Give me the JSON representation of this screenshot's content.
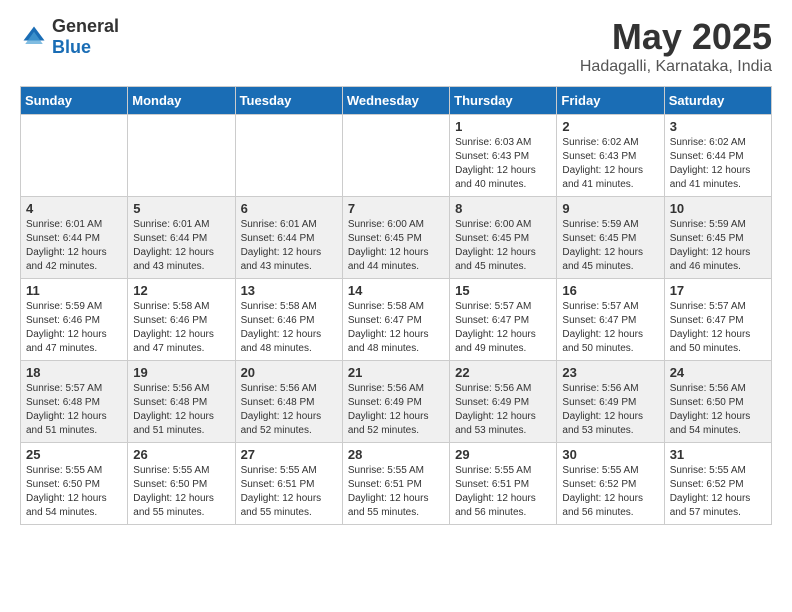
{
  "header": {
    "logo": {
      "general": "General",
      "blue": "Blue"
    },
    "title": "May 2025",
    "subtitle": "Hadagalli, Karnataka, India"
  },
  "weekdays": [
    "Sunday",
    "Monday",
    "Tuesday",
    "Wednesday",
    "Thursday",
    "Friday",
    "Saturday"
  ],
  "weeks": [
    [
      {
        "day": "",
        "info": ""
      },
      {
        "day": "",
        "info": ""
      },
      {
        "day": "",
        "info": ""
      },
      {
        "day": "",
        "info": ""
      },
      {
        "day": "1",
        "info": "Sunrise: 6:03 AM\nSunset: 6:43 PM\nDaylight: 12 hours\nand 40 minutes."
      },
      {
        "day": "2",
        "info": "Sunrise: 6:02 AM\nSunset: 6:43 PM\nDaylight: 12 hours\nand 41 minutes."
      },
      {
        "day": "3",
        "info": "Sunrise: 6:02 AM\nSunset: 6:44 PM\nDaylight: 12 hours\nand 41 minutes."
      }
    ],
    [
      {
        "day": "4",
        "info": "Sunrise: 6:01 AM\nSunset: 6:44 PM\nDaylight: 12 hours\nand 42 minutes."
      },
      {
        "day": "5",
        "info": "Sunrise: 6:01 AM\nSunset: 6:44 PM\nDaylight: 12 hours\nand 43 minutes."
      },
      {
        "day": "6",
        "info": "Sunrise: 6:01 AM\nSunset: 6:44 PM\nDaylight: 12 hours\nand 43 minutes."
      },
      {
        "day": "7",
        "info": "Sunrise: 6:00 AM\nSunset: 6:45 PM\nDaylight: 12 hours\nand 44 minutes."
      },
      {
        "day": "8",
        "info": "Sunrise: 6:00 AM\nSunset: 6:45 PM\nDaylight: 12 hours\nand 45 minutes."
      },
      {
        "day": "9",
        "info": "Sunrise: 5:59 AM\nSunset: 6:45 PM\nDaylight: 12 hours\nand 45 minutes."
      },
      {
        "day": "10",
        "info": "Sunrise: 5:59 AM\nSunset: 6:45 PM\nDaylight: 12 hours\nand 46 minutes."
      }
    ],
    [
      {
        "day": "11",
        "info": "Sunrise: 5:59 AM\nSunset: 6:46 PM\nDaylight: 12 hours\nand 47 minutes."
      },
      {
        "day": "12",
        "info": "Sunrise: 5:58 AM\nSunset: 6:46 PM\nDaylight: 12 hours\nand 47 minutes."
      },
      {
        "day": "13",
        "info": "Sunrise: 5:58 AM\nSunset: 6:46 PM\nDaylight: 12 hours\nand 48 minutes."
      },
      {
        "day": "14",
        "info": "Sunrise: 5:58 AM\nSunset: 6:47 PM\nDaylight: 12 hours\nand 48 minutes."
      },
      {
        "day": "15",
        "info": "Sunrise: 5:57 AM\nSunset: 6:47 PM\nDaylight: 12 hours\nand 49 minutes."
      },
      {
        "day": "16",
        "info": "Sunrise: 5:57 AM\nSunset: 6:47 PM\nDaylight: 12 hours\nand 50 minutes."
      },
      {
        "day": "17",
        "info": "Sunrise: 5:57 AM\nSunset: 6:47 PM\nDaylight: 12 hours\nand 50 minutes."
      }
    ],
    [
      {
        "day": "18",
        "info": "Sunrise: 5:57 AM\nSunset: 6:48 PM\nDaylight: 12 hours\nand 51 minutes."
      },
      {
        "day": "19",
        "info": "Sunrise: 5:56 AM\nSunset: 6:48 PM\nDaylight: 12 hours\nand 51 minutes."
      },
      {
        "day": "20",
        "info": "Sunrise: 5:56 AM\nSunset: 6:48 PM\nDaylight: 12 hours\nand 52 minutes."
      },
      {
        "day": "21",
        "info": "Sunrise: 5:56 AM\nSunset: 6:49 PM\nDaylight: 12 hours\nand 52 minutes."
      },
      {
        "day": "22",
        "info": "Sunrise: 5:56 AM\nSunset: 6:49 PM\nDaylight: 12 hours\nand 53 minutes."
      },
      {
        "day": "23",
        "info": "Sunrise: 5:56 AM\nSunset: 6:49 PM\nDaylight: 12 hours\nand 53 minutes."
      },
      {
        "day": "24",
        "info": "Sunrise: 5:56 AM\nSunset: 6:50 PM\nDaylight: 12 hours\nand 54 minutes."
      }
    ],
    [
      {
        "day": "25",
        "info": "Sunrise: 5:55 AM\nSunset: 6:50 PM\nDaylight: 12 hours\nand 54 minutes."
      },
      {
        "day": "26",
        "info": "Sunrise: 5:55 AM\nSunset: 6:50 PM\nDaylight: 12 hours\nand 55 minutes."
      },
      {
        "day": "27",
        "info": "Sunrise: 5:55 AM\nSunset: 6:51 PM\nDaylight: 12 hours\nand 55 minutes."
      },
      {
        "day": "28",
        "info": "Sunrise: 5:55 AM\nSunset: 6:51 PM\nDaylight: 12 hours\nand 55 minutes."
      },
      {
        "day": "29",
        "info": "Sunrise: 5:55 AM\nSunset: 6:51 PM\nDaylight: 12 hours\nand 56 minutes."
      },
      {
        "day": "30",
        "info": "Sunrise: 5:55 AM\nSunset: 6:52 PM\nDaylight: 12 hours\nand 56 minutes."
      },
      {
        "day": "31",
        "info": "Sunrise: 5:55 AM\nSunset: 6:52 PM\nDaylight: 12 hours\nand 57 minutes."
      }
    ]
  ]
}
